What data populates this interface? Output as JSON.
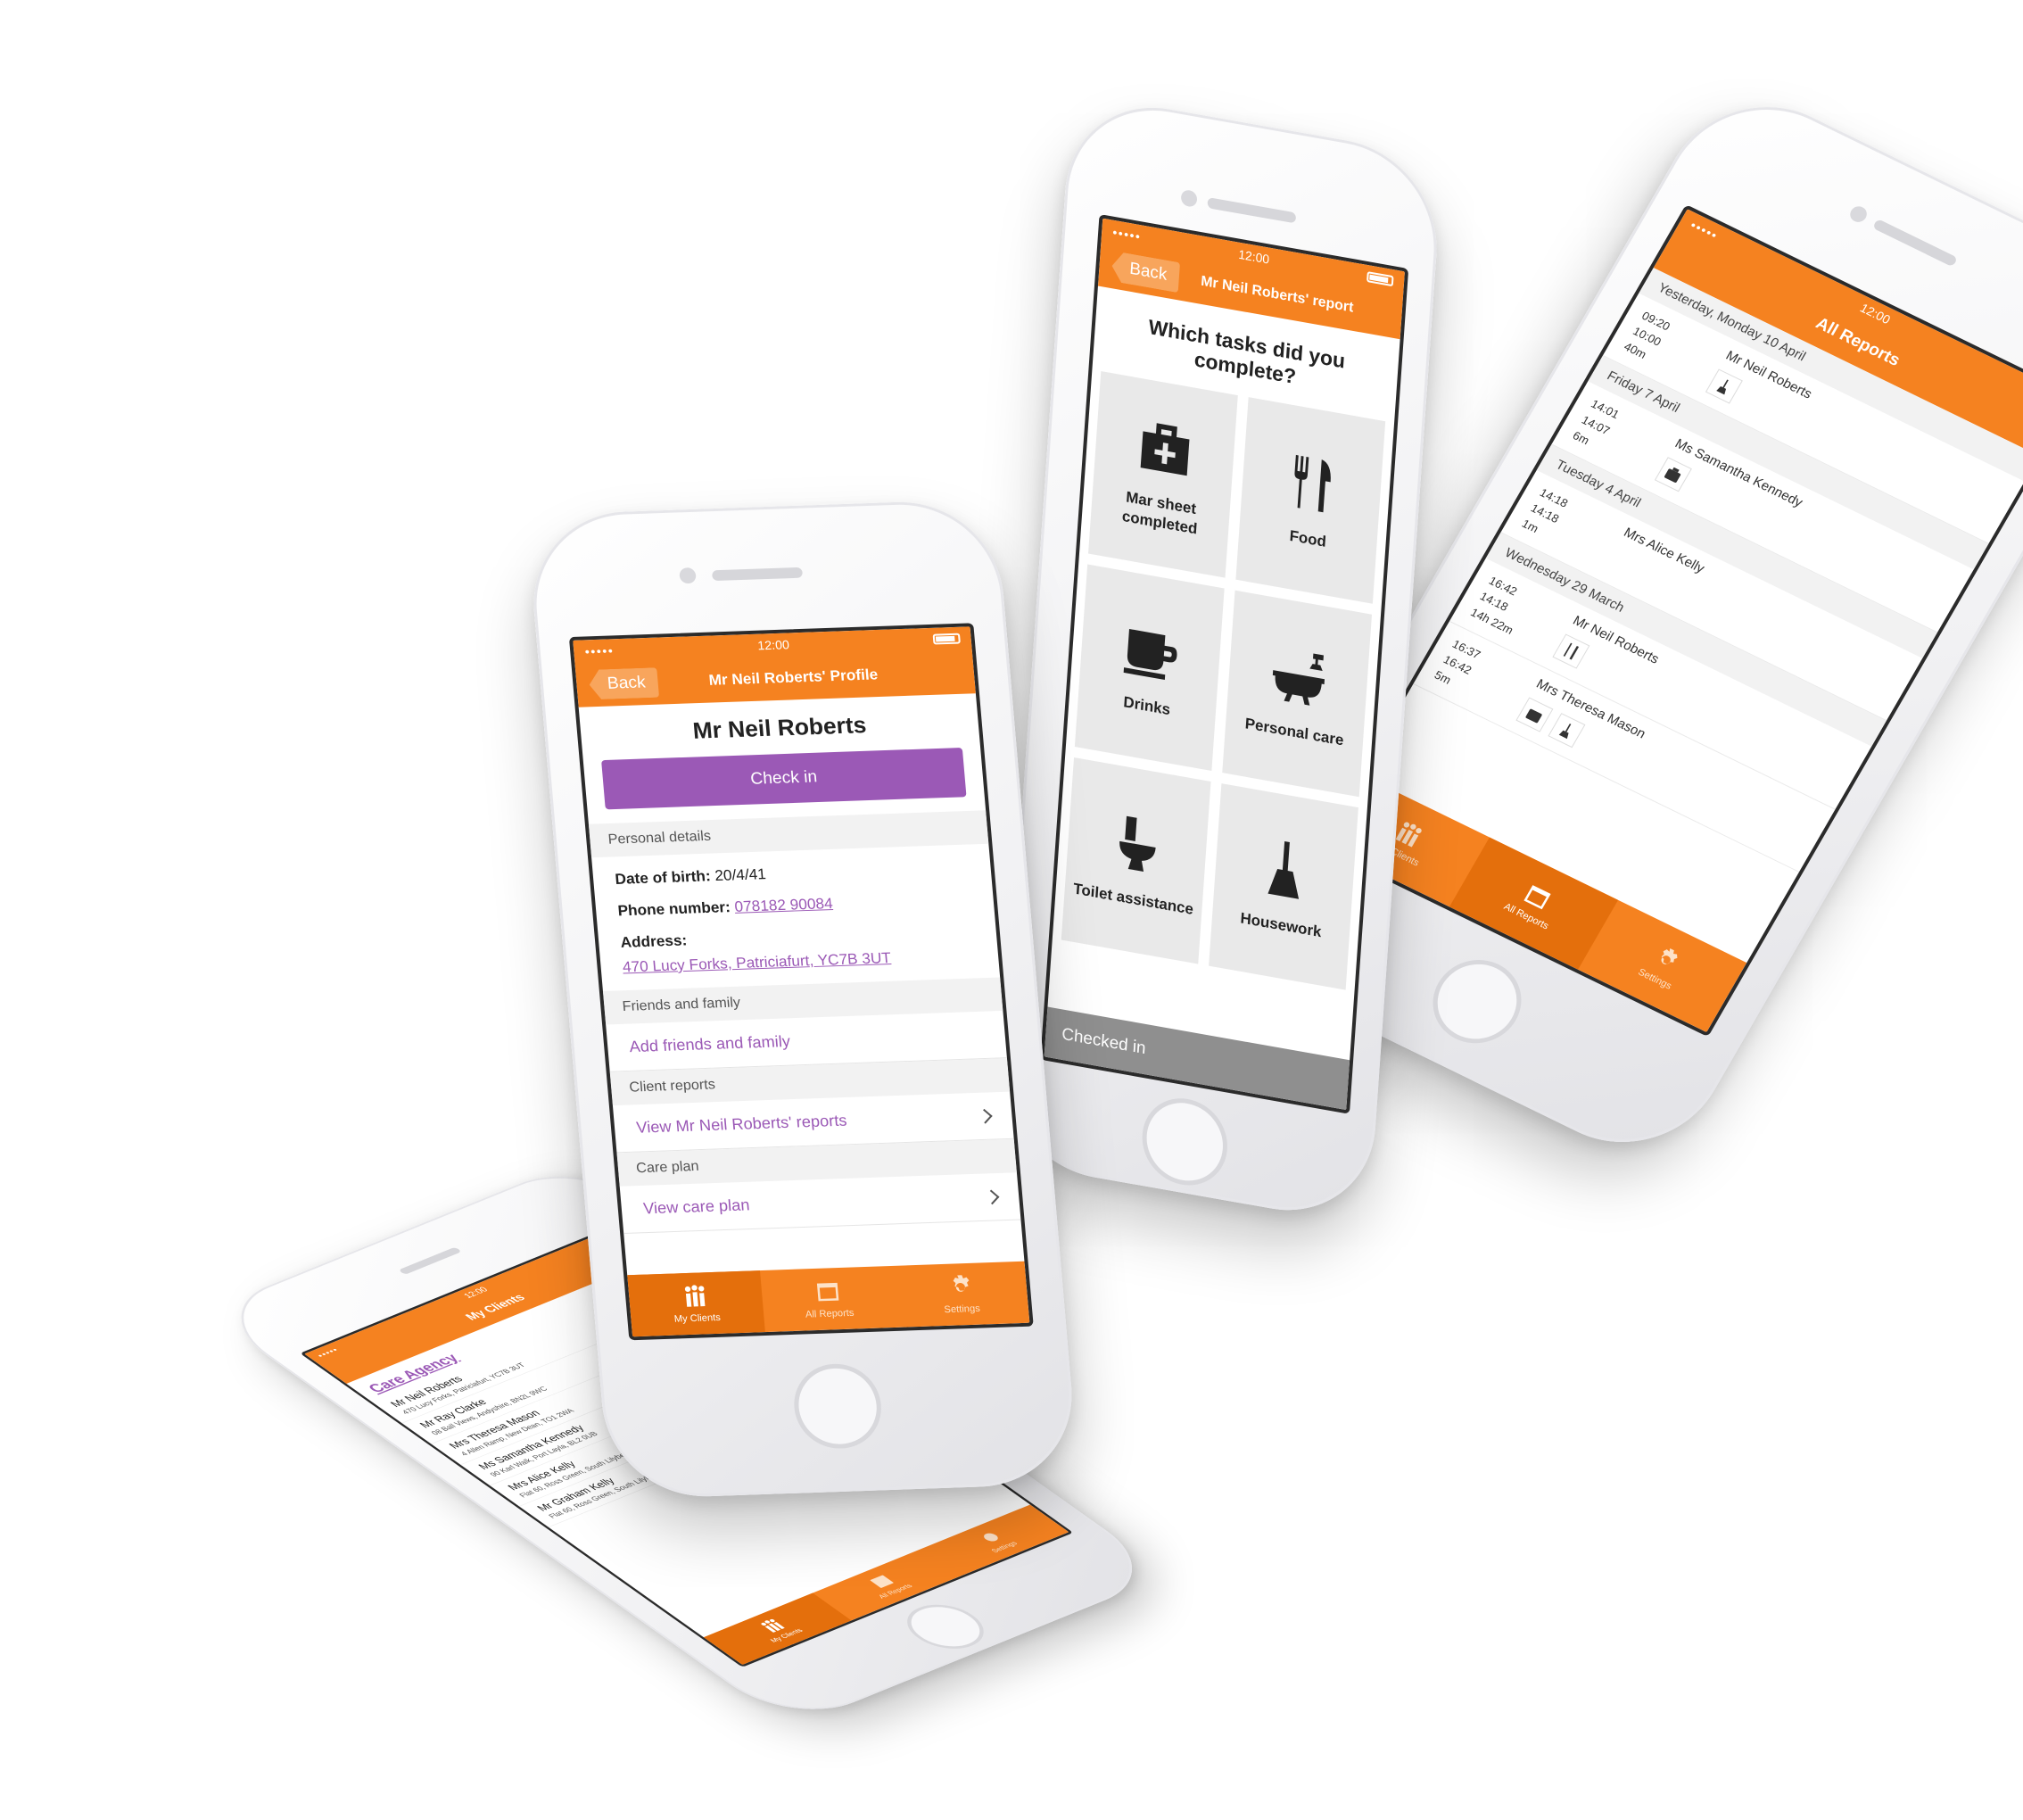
{
  "status": {
    "time": "12:00"
  },
  "tabs": {
    "my_clients": "My Clients",
    "all_reports": "All Reports",
    "settings": "Settings"
  },
  "profile": {
    "back": "Back",
    "title": "Mr Neil Roberts' Profile",
    "name": "Mr Neil Roberts",
    "checkin": "Check in",
    "personal_details": "Personal details",
    "dob_label": "Date of birth:",
    "dob": "20/4/41",
    "phone_label": "Phone number:",
    "phone": "078182 90084",
    "address_label": "Address:",
    "address": "470 Lucy Forks, Patriciafurt, YC7B 3UT",
    "friends_head": "Friends and family",
    "add_friends": "Add friends and family",
    "reports_head": "Client reports",
    "view_reports": "View Mr Neil Roberts' reports",
    "careplan_head": "Care plan",
    "view_careplan": "View care plan"
  },
  "report": {
    "back": "Back",
    "title": "Mr Neil Roberts' report",
    "question": "Which tasks did you complete?",
    "tasks": [
      {
        "label": "Mar sheet completed",
        "icon": "medical-bag-icon"
      },
      {
        "label": "Food",
        "icon": "cutlery-icon"
      },
      {
        "label": "Drinks",
        "icon": "mug-icon"
      },
      {
        "label": "Personal care",
        "icon": "bathtub-icon"
      },
      {
        "label": "Toilet assistance",
        "icon": "toilet-icon"
      },
      {
        "label": "Housework",
        "icon": "broom-icon"
      }
    ],
    "checked_in": "Checked in"
  },
  "reports": {
    "title": "All Reports",
    "days": [
      {
        "day": "Yesterday, Monday 10 April",
        "entries": [
          {
            "start": "09:20",
            "end": "10:00",
            "dur": "40m",
            "name": "Mr Neil Roberts",
            "icons": [
              "housework-icon"
            ]
          }
        ]
      },
      {
        "day": "Friday 7 April",
        "entries": [
          {
            "start": "14:01",
            "end": "14:07",
            "dur": "6m",
            "name": "Ms Samantha Kennedy",
            "icons": [
              "medical-bag-icon"
            ]
          }
        ]
      },
      {
        "day": "Tuesday 4 April",
        "entries": [
          {
            "start": "14:18",
            "end": "14:18",
            "dur": "1m",
            "name": "Mrs Alice Kelly",
            "icons": []
          }
        ]
      },
      {
        "day": "Wednesday 29 March",
        "entries": [
          {
            "start": "16:42",
            "end": "14:18",
            "dur": "14h 22m",
            "name": "Mr Neil Roberts",
            "icons": [
              "cutlery-icon"
            ]
          },
          {
            "start": "16:37",
            "end": "16:42",
            "dur": "5m",
            "name": "Mrs Theresa Mason",
            "icons": [
              "medical-bag-icon",
              "broom-icon"
            ]
          }
        ]
      }
    ]
  },
  "clients": {
    "title": "My Clients",
    "agency": "Care Agency",
    "list": [
      {
        "name": "Mr Neil Roberts",
        "address": "470 Lucy Forks, Patriciafurt, YC7B 3UT"
      },
      {
        "name": "Mr Ray Clarke",
        "address": "08 Ball Views, Andyshire, BN2L 9WC"
      },
      {
        "name": "Mrs Theresa Mason",
        "address": "4 Allen Ramp, New Dean, TO1 2WA"
      },
      {
        "name": "Ms Samantha Kennedy",
        "address": "90 Karl Walk, Port Layla, BL2 0UB"
      },
      {
        "name": "Mrs Alice Kelly",
        "address": "Flat 60, Ross Green, South Lilyberg, GT4 6ZY"
      },
      {
        "name": "Mr Graham Kelly",
        "address": "Flat 60, Ross Green, South Lilyberg, GT4 6ZY"
      }
    ]
  },
  "colors": {
    "orange": "#f58220",
    "purple": "#9b59b6",
    "tile": "#e9e9e9"
  }
}
